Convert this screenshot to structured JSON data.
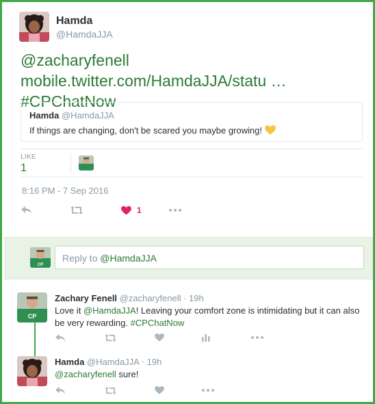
{
  "main_tweet": {
    "author_name": "Hamda",
    "author_handle": "@HamdaJJA",
    "text_mention": "@zacharyfenell",
    "text_link": "mobile.twitter.com/HamdaJJA/statu …",
    "text_hashtag": "#CPChatNow",
    "quote": {
      "name": "Hamda",
      "handle": "@HamdaJJA",
      "text": "If things are changing, don't be scared you maybe growing!"
    },
    "likes_label": "LIKE",
    "likes_count": "1",
    "timestamp": "8:16 PM - 7 Sep 2016",
    "action_like_count": "1"
  },
  "reply_box": {
    "prefix": "Reply to ",
    "mention": "@HamdaJJA"
  },
  "replies": [
    {
      "name": "Zachary Fenell",
      "handle": "@zacharyfenell",
      "time": "· 19h",
      "text_pre": "Love it ",
      "mention": "@HamdaJJA",
      "text_mid": "! Leaving your comfort zone is intimidating but it can also be very rewarding. ",
      "hashtag": "#CPChatNow"
    },
    {
      "name": "Hamda",
      "handle": "@HamdaJJA",
      "time": "· 19h",
      "mention": "@zacharyfenell",
      "text_post": " sure!"
    }
  ],
  "icons": {
    "reply": "reply-icon",
    "retweet": "retweet-icon",
    "like": "heart-icon",
    "more": "more-icon",
    "analytics": "analytics-icon"
  },
  "colors": {
    "frame": "#3fa94a",
    "link": "#2b7a33",
    "heart": "#e0245e",
    "reply_bg": "#e8f3e6"
  }
}
